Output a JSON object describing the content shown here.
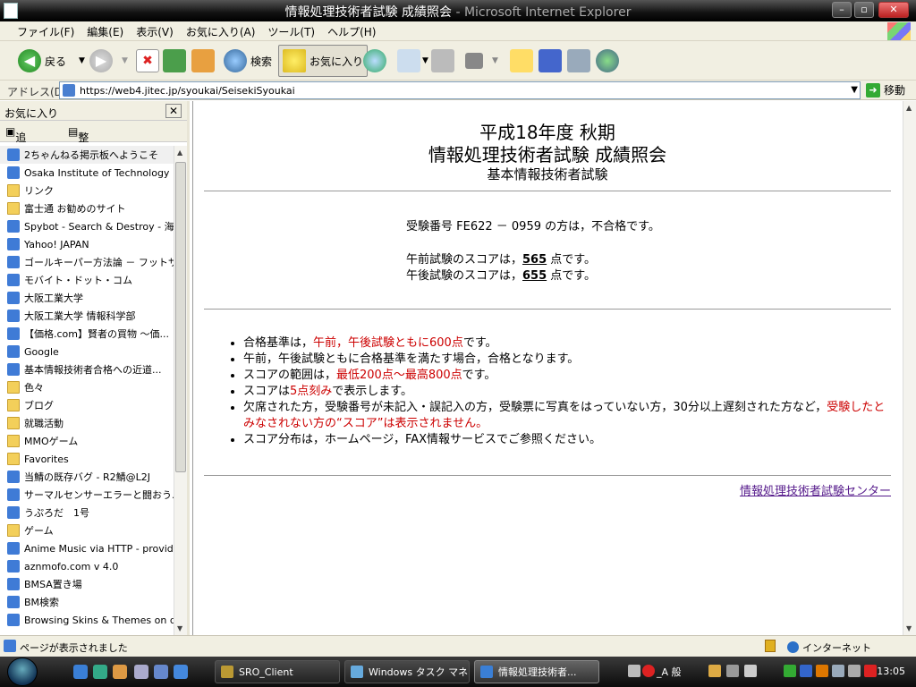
{
  "window": {
    "title": "情報処理技術者試験 成績照会",
    "title_suffix": " - Microsoft Internet Explorer"
  },
  "menu": [
    "ファイル(F)",
    "編集(E)",
    "表示(V)",
    "お気に入り(A)",
    "ツール(T)",
    "ヘルプ(H)"
  ],
  "toolbar": {
    "back_label": "戻る",
    "search_label": "検索",
    "favorites_label": "お気に入り"
  },
  "address": {
    "label": "アドレス(D)",
    "url": "https://web4.jitec.jp/syoukai/SeisekiSyoukai",
    "go_label": "移動"
  },
  "favorites_panel": {
    "title": "お気に入り",
    "add_label": "追加...",
    "organize_label": "整理...",
    "items": [
      {
        "label": "2ちゃんねる掲示板へようこそ",
        "icon": "ie-page-icon"
      },
      {
        "label": "Osaka Institute of Technology ...",
        "icon": "ie-page-icon"
      },
      {
        "label": "リンク",
        "icon": "folder-icon"
      },
      {
        "label": "富士通 お勧めのサイト",
        "icon": "folder-icon"
      },
      {
        "label": "Spybot - Search & Destroy - 海...",
        "icon": "ie-page-icon"
      },
      {
        "label": "Yahoo! JAPAN",
        "icon": "ie-page-icon"
      },
      {
        "label": "ゴールキーパー方法論 － フットサ...",
        "icon": "ie-page-icon"
      },
      {
        "label": "モバイト・ドット・コム",
        "icon": "ie-page-icon"
      },
      {
        "label": "大阪工業大学",
        "icon": "ie-page-icon"
      },
      {
        "label": "大阪工業大学 情報科学部",
        "icon": "ie-page-icon"
      },
      {
        "label": "【価格.com】賢者の買物 ～価...",
        "icon": "ie-page-icon"
      },
      {
        "label": "Google",
        "icon": "ie-page-icon"
      },
      {
        "label": "基本情報技術者合格への近道...",
        "icon": "ie-page-icon"
      },
      {
        "label": "色々",
        "icon": "folder-icon"
      },
      {
        "label": "ブログ",
        "icon": "folder-icon"
      },
      {
        "label": "就職活動",
        "icon": "folder-icon"
      },
      {
        "label": "MMOゲーム",
        "icon": "folder-icon"
      },
      {
        "label": "Favorites",
        "icon": "folder-icon"
      },
      {
        "label": "当鯖の既存バグ - R2鯖@L2J",
        "icon": "ie-page-icon"
      },
      {
        "label": "サーマルセンサーエラーと闘おう...",
        "icon": "ie-page-icon"
      },
      {
        "label": "うぷろだ　1号",
        "icon": "ie-page-icon"
      },
      {
        "label": "ゲーム",
        "icon": "folder-icon"
      },
      {
        "label": "Anime Music via HTTP - provide...",
        "icon": "ie-page-icon"
      },
      {
        "label": "aznmofo.com v 4.0",
        "icon": "ie-page-icon"
      },
      {
        "label": "BMSA置き場",
        "icon": "ie-page-icon"
      },
      {
        "label": "BM検索",
        "icon": "ie-page-icon"
      },
      {
        "label": "Browsing Skins & Themes on de...",
        "icon": "ie-page-icon"
      }
    ]
  },
  "page": {
    "title_line1": "平成18年度 秋期",
    "title_line2": "情報処理技術者試験 成績照会",
    "subtitle": "基本情報技術者試験",
    "result_line": "受験番号 FE622 － 0959 の方は，不合格です。",
    "am_prefix": "午前試験のスコアは，",
    "am_score": "565",
    "am_suffix": " 点です。",
    "pm_prefix": "午後試験のスコアは，",
    "pm_score": "655",
    "pm_suffix": " 点です。",
    "notes": [
      {
        "pre": "合格基準は，",
        "red": "午前，午後試験ともに600点",
        "post": "です。"
      },
      {
        "pre": "午前，午後試験ともに合格基準を満たす場合，合格となります。",
        "red": "",
        "post": ""
      },
      {
        "pre": "スコアの範囲は，",
        "red": "最低200点～最高800点",
        "post": "です。"
      },
      {
        "pre": "スコアは",
        "red": "5点刻み",
        "post": "で表示します。"
      },
      {
        "pre": "欠席された方，受験番号が未記入・誤記入の方，受験票に写真をはっていない方，30分以上遅刻された方など，",
        "red": "受験したとみなされない方の“スコア”は表示されません。",
        "post": ""
      },
      {
        "pre": "スコア分布は，ホームページ，FAX情報サービスでご参照ください。",
        "red": "",
        "post": ""
      }
    ],
    "center_link": "情報処理技術者試験センター"
  },
  "status": {
    "text": "ページが表示されました",
    "zone": "インターネット"
  },
  "taskbar": {
    "tasks": [
      "SRO_Client",
      "Windows タスク マネ...",
      "情報処理技術者..."
    ],
    "ime": "_A 般",
    "clock": "13:05"
  },
  "colors": {
    "emphasis_red": "#cc0000",
    "link_visited": "#551a8b"
  }
}
